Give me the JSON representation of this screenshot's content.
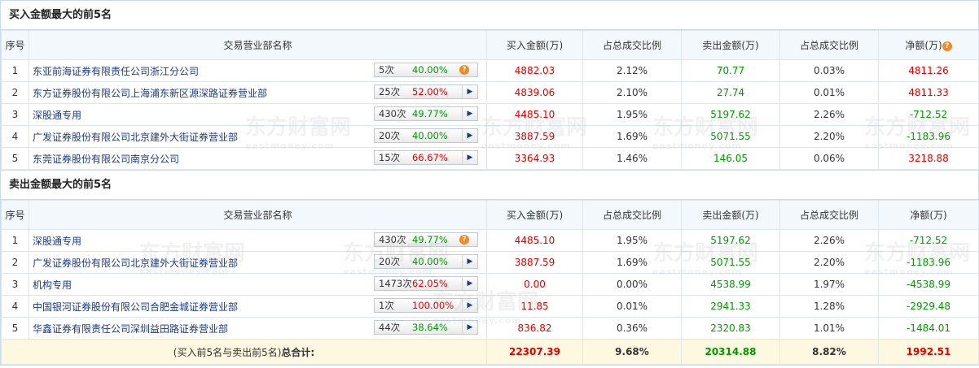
{
  "columns": [
    "序号",
    "交易营业部名称",
    "买入金额(万)",
    "占总成交比例",
    "卖出金额(万)",
    "占总成交比例",
    "净额(万)"
  ],
  "buy_section": {
    "title": "买入金额最大的前5名",
    "rows": [
      {
        "idx": "1",
        "name": "东亚前海证券有限责任公司浙江分公司",
        "count": "5次",
        "pct": "40.00%",
        "icon": "question-icon",
        "buy": "4882.03",
        "buy_ratio": "2.12%",
        "sell": "70.77",
        "sell_ratio": "0.03%",
        "net": "4811.26",
        "net_color": "red"
      },
      {
        "idx": "2",
        "name": "东方证券股份有限公司上海浦东新区源深路证券营业部",
        "count": "25次",
        "pct": "52.00%",
        "icon": "arrow-icon",
        "buy": "4839.06",
        "buy_ratio": "2.10%",
        "sell": "27.74",
        "sell_ratio": "0.01%",
        "net": "4811.33",
        "net_color": "red"
      },
      {
        "idx": "3",
        "name": "深股通专用",
        "count": "430次",
        "pct": "49.77%",
        "icon": "arrow-icon",
        "buy": "4485.10",
        "buy_ratio": "1.95%",
        "sell": "5197.62",
        "sell_ratio": "2.26%",
        "net": "-712.52",
        "net_color": "green"
      },
      {
        "idx": "4",
        "name": "广发证券股份有限公司北京建外大街证券营业部",
        "count": "20次",
        "pct": "40.00%",
        "icon": "arrow-icon",
        "buy": "3887.59",
        "buy_ratio": "1.69%",
        "sell": "5071.55",
        "sell_ratio": "2.20%",
        "net": "-1183.96",
        "net_color": "green"
      },
      {
        "idx": "5",
        "name": "东莞证券股份有限公司南京分公司",
        "count": "15次",
        "pct": "66.67%",
        "icon": "arrow-icon",
        "buy": "3364.93",
        "buy_ratio": "1.46%",
        "sell": "146.05",
        "sell_ratio": "0.06%",
        "net": "3218.88",
        "net_color": "red"
      }
    ]
  },
  "sell_section": {
    "title": "卖出金额最大的前5名",
    "rows": [
      {
        "idx": "1",
        "name": "深股通专用",
        "count": "430次",
        "pct": "49.77%",
        "icon": "question-icon",
        "buy": "4485.10",
        "buy_ratio": "1.95%",
        "sell": "5197.62",
        "sell_ratio": "2.26%",
        "net": "-712.52",
        "net_color": "green"
      },
      {
        "idx": "2",
        "name": "广发证券股份有限公司北京建外大街证券营业部",
        "count": "20次",
        "pct": "40.00%",
        "icon": "arrow-icon",
        "buy": "3887.59",
        "buy_ratio": "1.69%",
        "sell": "5071.55",
        "sell_ratio": "2.20%",
        "net": "-1183.96",
        "net_color": "green"
      },
      {
        "idx": "3",
        "name": "机构专用",
        "count": "1473次",
        "pct": "62.05%",
        "icon": "arrow-icon",
        "buy": "0.00",
        "buy_ratio": "0.00%",
        "sell": "4538.99",
        "sell_ratio": "1.97%",
        "net": "-4538.99",
        "net_color": "green"
      },
      {
        "idx": "4",
        "name": "中国银河证券股份有限公司合肥金城证券营业部",
        "count": "1次",
        "pct": "100.00%",
        "icon": "arrow-icon",
        "buy": "11.85",
        "buy_ratio": "0.01%",
        "sell": "2941.33",
        "sell_ratio": "1.28%",
        "net": "-2929.48",
        "net_color": "green"
      },
      {
        "idx": "5",
        "name": "华鑫证券有限责任公司深圳益田路证券营业部",
        "count": "44次",
        "pct": "38.64%",
        "icon": "arrow-icon",
        "buy": "836.82",
        "buy_ratio": "0.36%",
        "sell": "2320.83",
        "sell_ratio": "1.01%",
        "net": "-1484.01",
        "net_color": "green"
      }
    ]
  },
  "total": {
    "label_prefix": "(买入前5名与卖出前5名)",
    "label_bold": "总合计:",
    "buy": "22307.39",
    "buy_ratio": "9.68%",
    "sell": "20314.88",
    "sell_ratio": "8.82%",
    "net": "1992.51"
  },
  "watermark": {
    "cn": "东方财富网",
    "en": "eastmoney.com"
  },
  "colors": {
    "red": "#e00000",
    "green": "#009900",
    "link": "#1a3a82",
    "header_bg": "#f3f8fd",
    "total_bg": "#fdf8df",
    "help_icon": "#f08a24"
  }
}
